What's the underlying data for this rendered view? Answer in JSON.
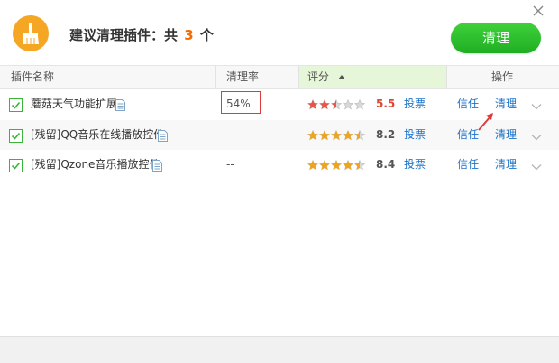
{
  "header": {
    "title_prefix": "建议清理插件：共",
    "count": "3",
    "title_suffix": "个",
    "clean_all_label": "清理"
  },
  "columns": {
    "name": "插件名称",
    "rate": "清理率",
    "rating": "评分",
    "action": "操作"
  },
  "rows": [
    {
      "name": "蘑菇天气功能扩展",
      "rate": "54%",
      "stars": 2.5,
      "score": "5.5",
      "score_color": "#e0452e",
      "vote": "投票",
      "trust": "信任",
      "clean": "清理"
    },
    {
      "name": "[残留]QQ音乐在线播放控件",
      "rate": "--",
      "stars": 4.5,
      "score": "8.2",
      "score_color": "#555555",
      "vote": "投票",
      "trust": "信任",
      "clean": "清理"
    },
    {
      "name": "[残留]Qzone音乐播放控件",
      "rate": "--",
      "stars": 4.5,
      "score": "8.4",
      "score_color": "#555555",
      "vote": "投票",
      "trust": "信任",
      "clean": "清理"
    }
  ],
  "colors": {
    "accent_green": "#2fbf2f",
    "link_blue": "#1e73c8",
    "count_orange": "#f56a00",
    "highlight_red": "#e03b3b"
  }
}
